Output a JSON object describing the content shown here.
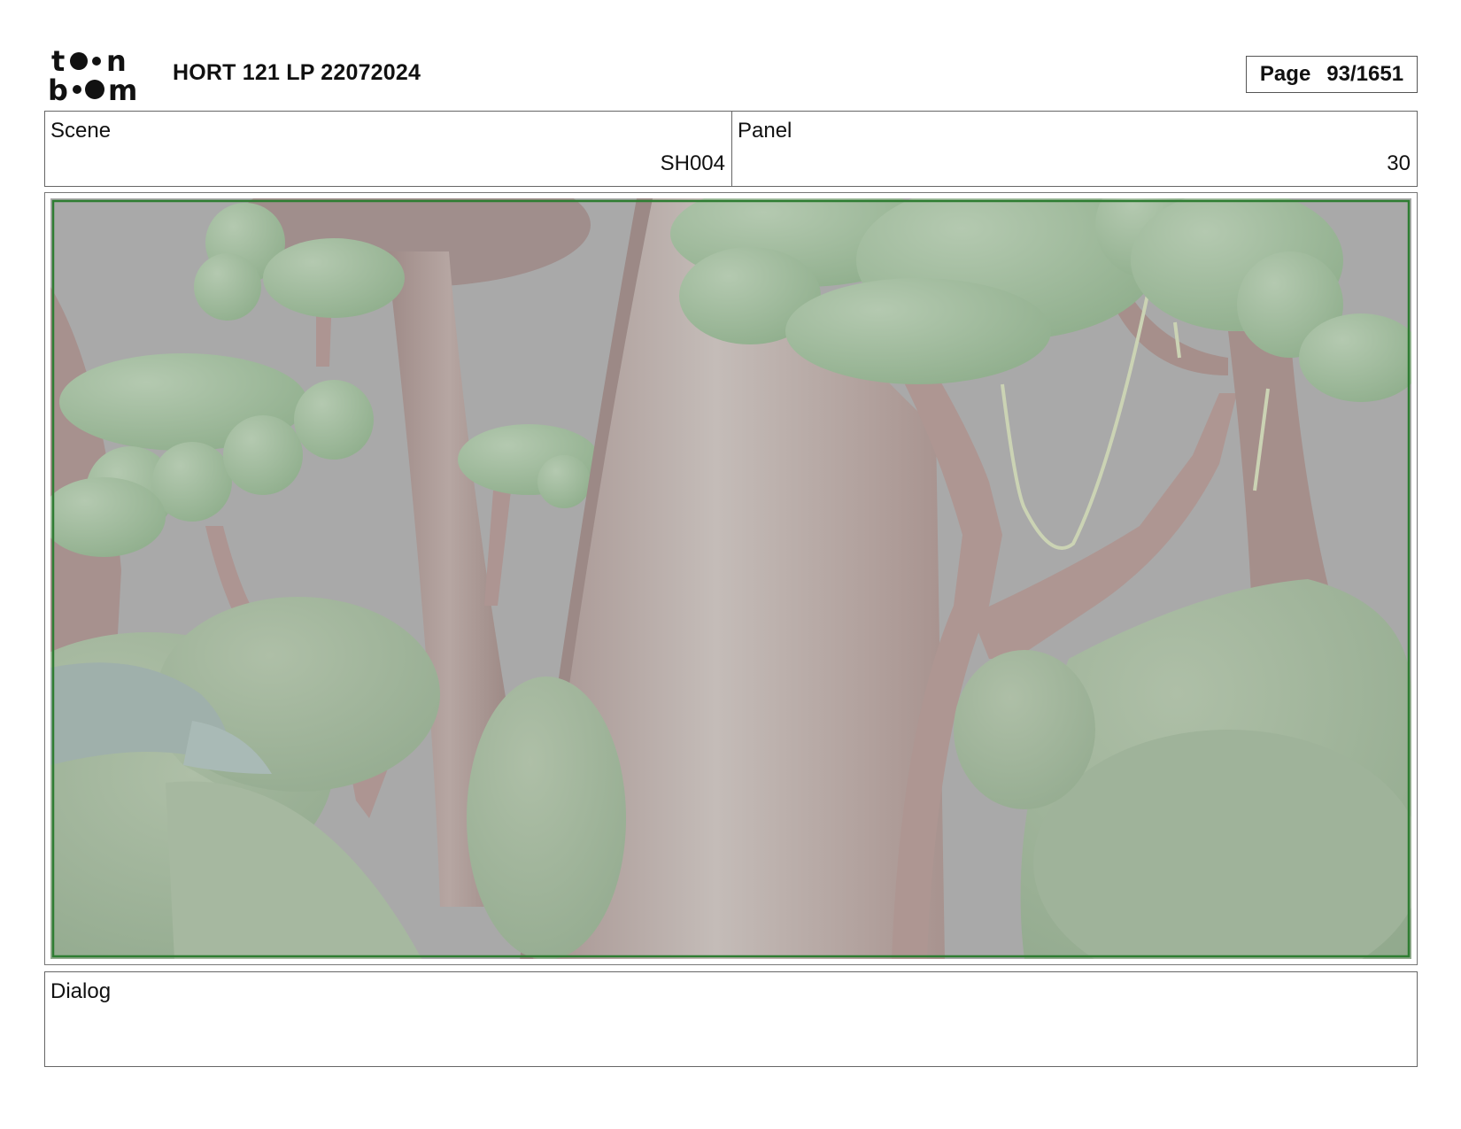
{
  "header": {
    "logo_name": "toon-boom-logo",
    "title": "HORT 121 LP 22072024",
    "page_label": "Page",
    "page_value": "93/1651"
  },
  "info": {
    "scene_label": "Scene",
    "scene_value": "SH004",
    "panel_label": "Panel",
    "panel_value": "30"
  },
  "frame": {
    "safe_area_color": "#2e7d32",
    "background_color": "#a9a9a9"
  },
  "dialog": {
    "label": "Dialog",
    "text": ""
  }
}
